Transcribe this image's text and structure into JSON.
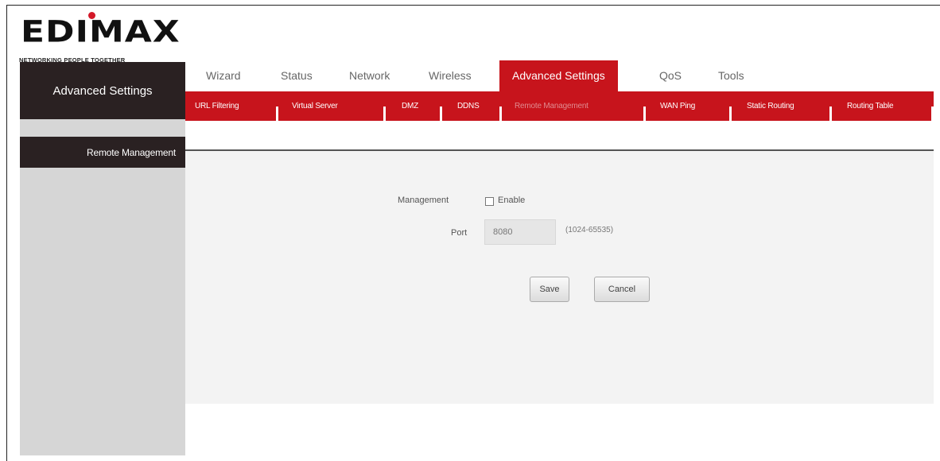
{
  "brand": {
    "logo_text": "EDIMAX",
    "tagline": "NETWORKING PEOPLE TOGETHER"
  },
  "colors": {
    "accent": "#c7141c",
    "sidebar_dark": "#2a2122",
    "sidebar_bg": "#d6d6d6"
  },
  "sidebar": {
    "header": "Advanced Settings",
    "items": [
      {
        "label": "Remote Management",
        "selected": true
      }
    ]
  },
  "topnav": {
    "tabs": [
      {
        "label": "Wizard",
        "active": false
      },
      {
        "label": "Status",
        "active": false
      },
      {
        "label": "Network",
        "active": false
      },
      {
        "label": "Wireless",
        "active": false
      },
      {
        "label": "Advanced Settings",
        "active": true
      },
      {
        "label": "QoS",
        "active": false
      },
      {
        "label": "Tools",
        "active": false
      }
    ]
  },
  "subnav": {
    "tabs": [
      {
        "label": "URL Filtering",
        "active": false
      },
      {
        "label": "Virtual Server",
        "active": false
      },
      {
        "label": "DMZ",
        "active": false
      },
      {
        "label": "DDNS",
        "active": false
      },
      {
        "label": "Remote Management",
        "active": true
      },
      {
        "label": "WAN Ping",
        "active": false
      },
      {
        "label": "Static Routing",
        "active": false
      },
      {
        "label": "Routing Table",
        "active": false
      }
    ]
  },
  "form": {
    "management_label": "Management",
    "enable_label": "Enable",
    "enable_checked": false,
    "port_label": "Port",
    "port_value": "8080",
    "port_hint": "(1024-65535)",
    "save_label": "Save",
    "cancel_label": "Cancel"
  }
}
